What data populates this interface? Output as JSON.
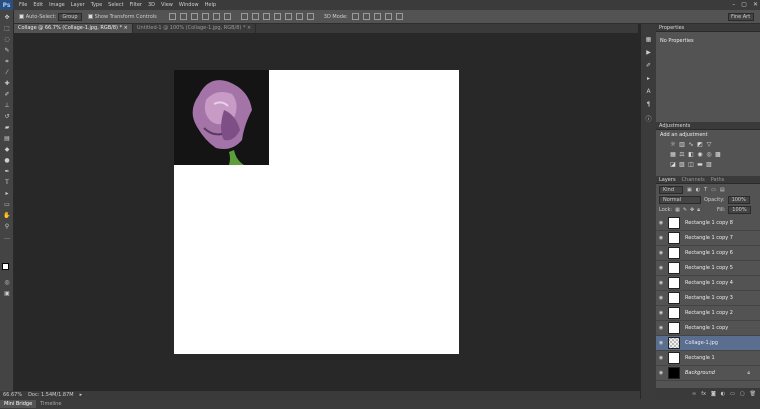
{
  "app": {
    "logo": "Ps"
  },
  "menu": [
    "File",
    "Edit",
    "Image",
    "Layer",
    "Type",
    "Select",
    "Filter",
    "3D",
    "View",
    "Window",
    "Help"
  ],
  "window_controls": {
    "minimize": "–",
    "restore": "▢",
    "close": "✕"
  },
  "options": {
    "auto_select_label": "Auto-Select:",
    "auto_select_value": "Group",
    "show_transform_label": "Show Transform Controls",
    "mode_3d_label": "3D Mode:",
    "workspace": "Fine Art"
  },
  "tabs": [
    {
      "label": "Collage @ 66.7% (Collage-1.jpg, RGB/8) * ×"
    },
    {
      "label": "Untitled-1 @ 100% (Collage-1.jpg, RGB/8) * ×"
    }
  ],
  "status": {
    "zoom": "66.67%",
    "doc": "Doc: 1.54M/1.87M"
  },
  "bottom_tabs": [
    "Mini Bridge",
    "Timeline"
  ],
  "properties": {
    "title": "Properties",
    "content": "No Properties"
  },
  "adjustments": {
    "title": "Adjustments",
    "heading": "Add an adjustment"
  },
  "layers_panel": {
    "tabs": [
      "Layers",
      "Channels",
      "Paths"
    ],
    "filter_kind": "Kind",
    "blend_mode": "Normal",
    "opacity_label": "Opacity:",
    "opacity_value": "100%",
    "lock_label": "Lock:",
    "fill_label": "Fill:",
    "fill_value": "100%",
    "layers": [
      {
        "name": "Rectangle 1 copy 8",
        "thumb": "white"
      },
      {
        "name": "Rectangle 1 copy 7",
        "thumb": "white"
      },
      {
        "name": "Rectangle 1 copy 6",
        "thumb": "white"
      },
      {
        "name": "Rectangle 1 copy 5",
        "thumb": "white"
      },
      {
        "name": "Rectangle 1 copy 4",
        "thumb": "white"
      },
      {
        "name": "Rectangle 1 copy 3",
        "thumb": "white"
      },
      {
        "name": "Rectangle 1 copy 2",
        "thumb": "white"
      },
      {
        "name": "Rectangle 1 copy",
        "thumb": "white"
      },
      {
        "name": "Collage-1.jpg",
        "thumb": "checker",
        "selected": true
      },
      {
        "name": "Rectangle 1",
        "thumb": "white"
      },
      {
        "name": "Background",
        "thumb": "black",
        "locked": true
      }
    ],
    "footer_icons": [
      "link-icon",
      "fx-icon",
      "mask-icon",
      "adjustment-icon",
      "folder-icon",
      "new-layer-icon",
      "trash-icon"
    ]
  },
  "colors": {
    "selected_layer": "#5a6e90",
    "panel": "#535353",
    "canvas_bg": "#282828"
  }
}
